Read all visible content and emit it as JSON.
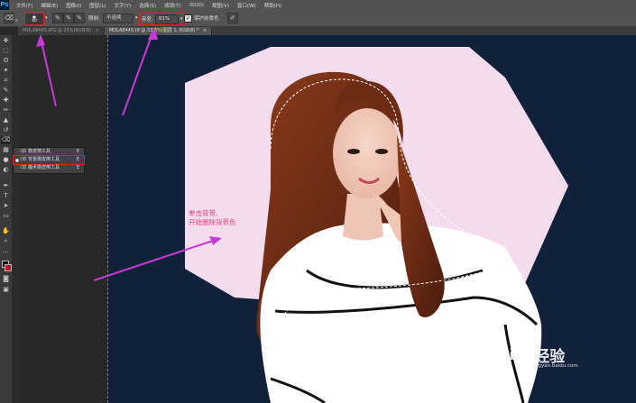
{
  "app": {
    "logo": "Ps"
  },
  "menubar": {
    "items": [
      "文件(F)",
      "编辑(E)",
      "图像(I)",
      "图层(L)",
      "文字(Y)",
      "选择(S)",
      "滤镜(T)",
      "3D(D)",
      "视图(V)",
      "窗口(W)",
      "帮助(H)"
    ]
  },
  "options": {
    "brush_size": "40",
    "brush_size_sub": "●",
    "sampling_label": "限制:",
    "sampling_value": "不连续",
    "tolerance_label": "容差:",
    "tolerance_value": "81%",
    "protect_label": "保护前景色",
    "protect_checked": "✓"
  },
  "tabs": [
    {
      "label": "MDLA8465.JPG @ 25%(RGB/8)"
    },
    {
      "label": "MDLA8445.tif @ 33.3%(图层 1, RGB/8) *"
    }
  ],
  "tab_close": "×",
  "flyout": {
    "items": [
      {
        "label": "橡皮擦工具",
        "key": "E",
        "bullet": ""
      },
      {
        "label": "背景橡皮擦工具",
        "key": "E",
        "bullet": "■"
      },
      {
        "label": "魔术橡皮擦工具",
        "key": "E",
        "bullet": ""
      }
    ]
  },
  "annotation": {
    "line1": "单击背景,",
    "line2": "开始删除背景色"
  },
  "watermark": {
    "brand": "Bai",
    "brand2": "经验",
    "sub": "jingyan.baidu.com"
  },
  "colors": {
    "arrow": "#c83ad8",
    "canvas_bg": "#12213a",
    "backdrop": "#f4dcef",
    "annotation": "#e0447a"
  }
}
